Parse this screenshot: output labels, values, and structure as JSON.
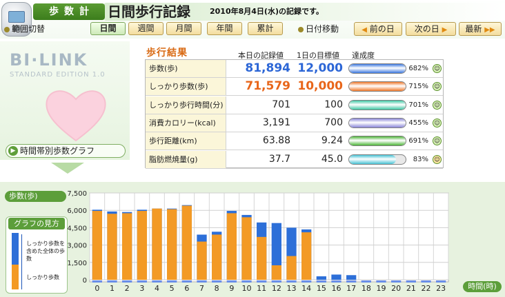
{
  "header": {
    "app_title": "歩数計",
    "page_title": "日間歩行記録",
    "record_date": "2010年8月4日(水)の記録です。"
  },
  "toolbar": {
    "range_label": "範囲切替",
    "range_buttons": [
      "日間",
      "週間",
      "月間",
      "年間",
      "累計"
    ],
    "date_move_label": "日付移動",
    "prev_label": "前の日",
    "next_label": "次の日",
    "latest_label": "最新"
  },
  "brand": {
    "logo": "BI·LINK",
    "edition": "STANDARD EDITION 1.0",
    "graph_button": "時間帯別歩数グラフ"
  },
  "results": {
    "title": "歩行結果",
    "col_today": "本日の記録値",
    "col_target": "1日の目標値",
    "col_rate": "達成度",
    "rows": [
      {
        "label": "歩数(歩)",
        "today": "81,894",
        "target": "12,000",
        "pct": "682%",
        "rate": 1.0,
        "color": "#3b78e0",
        "style": "big",
        "tcolor": "#2c66d6"
      },
      {
        "label": "しっかり歩数(歩)",
        "today": "71,579",
        "target": "10,000",
        "pct": "715%",
        "rate": 1.0,
        "color": "#f0782a",
        "style": "big",
        "tcolor": "#e8661a"
      },
      {
        "label": "しっかり歩行時間(分)",
        "today": "701",
        "target": "100",
        "pct": "701%",
        "rate": 1.0,
        "color": "#3ec7a4",
        "style": "",
        "tcolor": "#222222"
      },
      {
        "label": "消費カロリー(kcal)",
        "today": "3,191",
        "target": "700",
        "pct": "455%",
        "rate": 1.0,
        "color": "#8a86d8",
        "style": "",
        "tcolor": "#222222"
      },
      {
        "label": "歩行距離(km)",
        "today": "63.88",
        "target": "9.24",
        "pct": "691%",
        "rate": 1.0,
        "color": "#4fb63a",
        "style": "",
        "tcolor": "#222222"
      },
      {
        "label": "脂肪燃焼量(g)",
        "today": "37.7",
        "target": "45.0",
        "pct": "83%",
        "rate": 0.83,
        "color": "#47c3d6",
        "style": "",
        "tcolor": "#222222"
      }
    ]
  },
  "chart_labels": {
    "y_unit": "歩数(歩)",
    "x_unit": "時間(時)",
    "legend_title": "グラフの見方",
    "legend_total": "しっかり歩数を含めた全体の歩数",
    "legend_firm": "しっかり歩数"
  },
  "chart_data": {
    "type": "bar",
    "categories": [
      "0",
      "1",
      "2",
      "3",
      "4",
      "5",
      "6",
      "7",
      "8",
      "9",
      "10",
      "11",
      "12",
      "13",
      "14",
      "15",
      "16",
      "17",
      "18",
      "19",
      "20",
      "21",
      "22",
      "23"
    ],
    "series": [
      {
        "name": "しっかり歩数",
        "values": [
          5950,
          5700,
          5750,
          5950,
          6150,
          6100,
          6400,
          3300,
          3900,
          5750,
          5400,
          3700,
          1250,
          2050,
          4100,
          0,
          0,
          0,
          0,
          0,
          0,
          0,
          0,
          0
        ]
      },
      {
        "name": "全体の歩数",
        "values": [
          6050,
          5900,
          5850,
          6050,
          6150,
          6150,
          6450,
          3900,
          4150,
          5950,
          5600,
          4950,
          4900,
          4500,
          4350,
          300,
          450,
          400,
          0,
          0,
          0,
          0,
          0,
          0
        ]
      }
    ],
    "yticks": [
      "0",
      "1,500",
      "3,000",
      "4,500",
      "6,000",
      "7,500"
    ],
    "ylim": [
      0,
      7500
    ],
    "grid": true,
    "colors": {
      "firm": "#f39a25",
      "total": "#2d6fd8"
    }
  }
}
